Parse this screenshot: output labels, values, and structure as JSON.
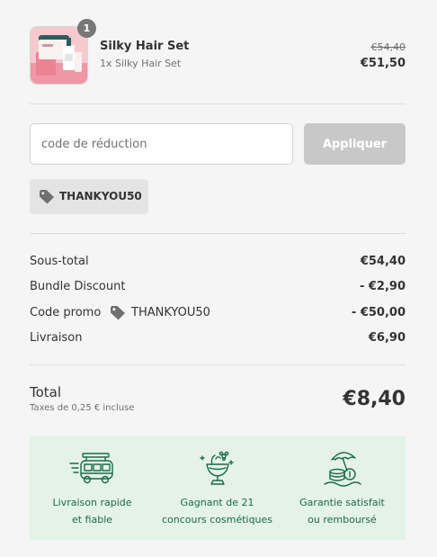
{
  "product": {
    "quantity": "1",
    "name": "Silky Hair Set",
    "variant": "1x Silky Hair Set",
    "original_price": "€54,40",
    "price": "€51,50"
  },
  "discount": {
    "placeholder": "code de réduction",
    "apply_label": "Appliquer",
    "applied_code": "THANKYOU50"
  },
  "summary": {
    "subtotal_label": "Sous-total",
    "subtotal_value": "€54,40",
    "bundle_label": "Bundle Discount",
    "bundle_value": "- €2,90",
    "promo_label": "Code promo",
    "promo_code": "THANKYOU50",
    "promo_value": "- €50,00",
    "shipping_label": "Livraison",
    "shipping_value": "€6,90"
  },
  "total": {
    "label": "Total",
    "tax_note": "Taxes de 0,25 € incluse",
    "value": "€8,40"
  },
  "benefits": [
    {
      "icon": "delivery-van-icon",
      "line1": "Livraison rapide",
      "line2": "et fiable"
    },
    {
      "icon": "trophy-cup-icon",
      "line1": "Gagnant de 21",
      "line2": "concours cosmétiques"
    },
    {
      "icon": "money-umbrella-icon",
      "line1": "Garantie satisfait",
      "line2": "ou remboursé"
    }
  ],
  "colors": {
    "page_background": "#f5f5f5",
    "benefit_background": "#e4f2e7",
    "benefit_text": "#1a6b47",
    "apply_button_disabled": "#c8c8c8",
    "quantity_badge": "#777777"
  }
}
